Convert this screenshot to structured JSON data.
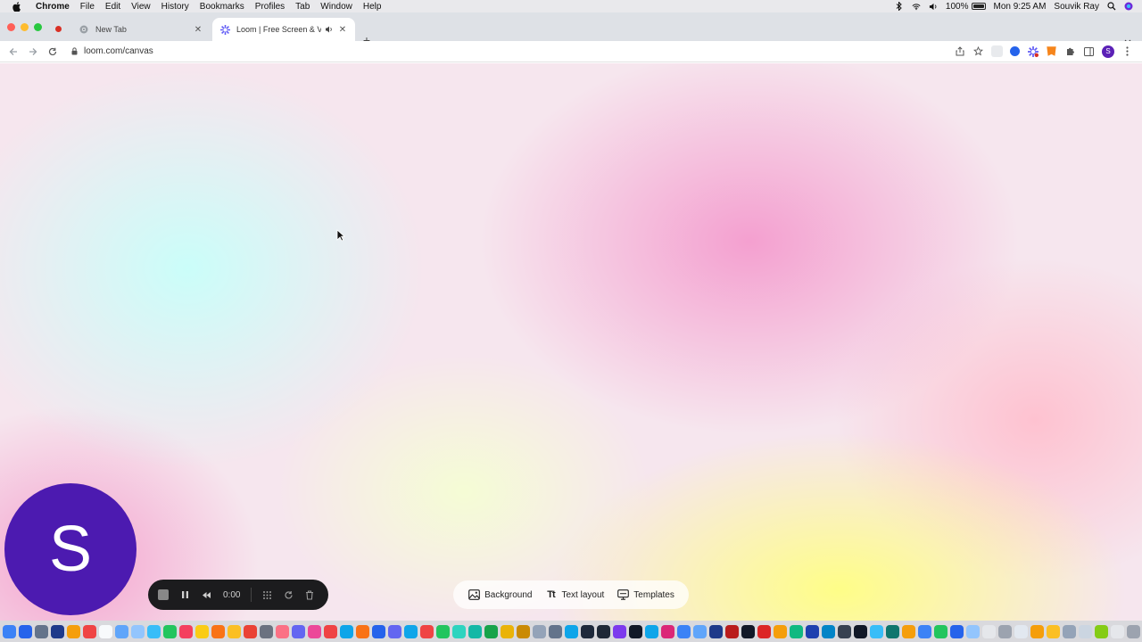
{
  "menubar": {
    "app": "Chrome",
    "items": [
      "File",
      "Edit",
      "View",
      "History",
      "Bookmarks",
      "Profiles",
      "Tab",
      "Window",
      "Help"
    ],
    "battery": "100%",
    "clock": "Mon 9:25 AM",
    "user": "Souvik Ray"
  },
  "tabs": [
    {
      "title": "New Tab"
    },
    {
      "title": "Loom | Free Screen & Vide"
    }
  ],
  "address": {
    "url": "loom.com/canvas"
  },
  "profile_initial": "S",
  "camera": {
    "initial": "S",
    "color": "#4c1ab0"
  },
  "recorder": {
    "timer": "0:00"
  },
  "canvas_toolbar": {
    "background_label": "Background",
    "text_layout_label": "Text layout",
    "templates_label": "Templates"
  },
  "dock": {
    "colors": [
      "#3b82f6",
      "#2563eb",
      "#64748b",
      "#1e3a8a",
      "#f59e0b",
      "#ef4444",
      "#f8fafc",
      "#60a5fa",
      "#93c5fd",
      "#38bdf8",
      "#22c55e",
      "#f43f5e",
      "#facc15",
      "#f97316",
      "#fbbf24",
      "#ea4335",
      "#6b7280",
      "#fb7185",
      "#6366f1",
      "#ec4899",
      "#ef4444",
      "#0ea5e9",
      "#f97316",
      "#2563eb",
      "#6366f1",
      "#0ea5e9",
      "#ef4444",
      "#22c55e",
      "#2dd4bf",
      "#14b8a6",
      "#16a34a",
      "#eab308",
      "#ca8a04",
      "#94a3b8",
      "#64748b",
      "#0ea5e9",
      "#1e293b",
      "#1f2937",
      "#7c3aed",
      "#111827",
      "#0ea5e9",
      "#db2777",
      "#3b82f6",
      "#60a5fa",
      "#1e3a8a",
      "#b91c1c",
      "#111827",
      "#dc2626",
      "#f59e0b",
      "#10b981",
      "#1e40af",
      "#0284c7",
      "#374151",
      "#111827",
      "#38bdf8",
      "#0f766e",
      "#f59e0b",
      "#3b82f6",
      "#22c55e",
      "#2563eb",
      "#93c5fd",
      "#e5e7eb",
      "#9ca3af",
      "#e2e8f0",
      "#f59e0b",
      "#fbbf24",
      "#94a3b8",
      "#cbd5e1",
      "#84cc16",
      "#e5e7eb",
      "#9ca3af"
    ]
  }
}
